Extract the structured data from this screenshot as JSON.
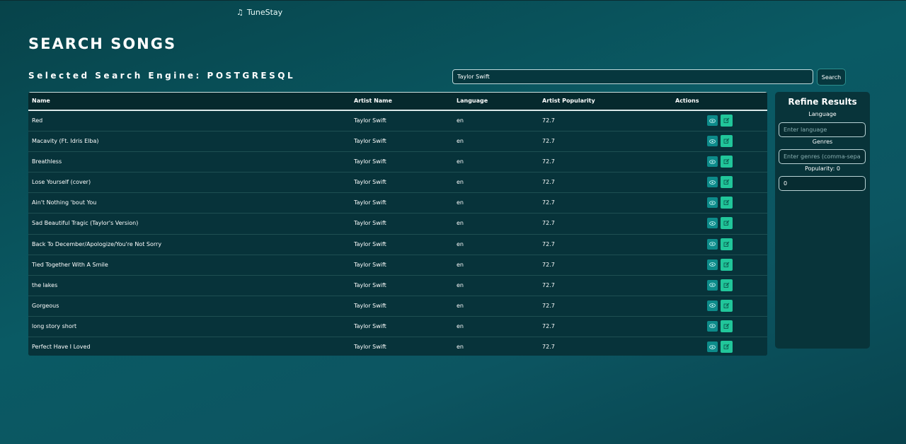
{
  "nav": {
    "brand": "TuneStay",
    "brand_icon": "music-note-icon"
  },
  "page": {
    "title": "SEARCH SONGS",
    "engine_label": "Selected Search Engine: POSTGRESQL"
  },
  "search": {
    "value": "Taylor Swift",
    "button_label": "Search"
  },
  "table": {
    "headers": {
      "name": "Name",
      "artist": "Artist Name",
      "language": "Language",
      "popularity": "Artist Popularity",
      "actions": "Actions"
    },
    "rows": [
      {
        "name": "Red",
        "artist": "Taylor Swift",
        "language": "en",
        "popularity": "72.7"
      },
      {
        "name": "Macavity (Ft. Idris Elba)",
        "artist": "Taylor Swift",
        "language": "en",
        "popularity": "72.7"
      },
      {
        "name": "Breathless",
        "artist": "Taylor Swift",
        "language": "en",
        "popularity": "72.7"
      },
      {
        "name": "Lose Yourself (cover)",
        "artist": "Taylor Swift",
        "language": "en",
        "popularity": "72.7"
      },
      {
        "name": "Ain't Nothing 'bout You",
        "artist": "Taylor Swift",
        "language": "en",
        "popularity": "72.7"
      },
      {
        "name": "Sad Beautiful Tragic (Taylor's Version)",
        "artist": "Taylor Swift",
        "language": "en",
        "popularity": "72.7"
      },
      {
        "name": "Back To December/Apologize/You're Not Sorry",
        "artist": "Taylor Swift",
        "language": "en",
        "popularity": "72.7"
      },
      {
        "name": "Tied Together With A Smile",
        "artist": "Taylor Swift",
        "language": "en",
        "popularity": "72.7"
      },
      {
        "name": "the lakes",
        "artist": "Taylor Swift",
        "language": "en",
        "popularity": "72.7"
      },
      {
        "name": "Gorgeous",
        "artist": "Taylor Swift",
        "language": "en",
        "popularity": "72.7"
      },
      {
        "name": "long story short",
        "artist": "Taylor Swift",
        "language": "en",
        "popularity": "72.7"
      },
      {
        "name": "Perfect Have I Loved",
        "artist": "Taylor Swift",
        "language": "en",
        "popularity": "72.7"
      }
    ]
  },
  "refine": {
    "title": "Refine Results",
    "language_label": "Language",
    "language_placeholder": "Enter language",
    "genres_label": "Genres",
    "genres_placeholder": "Enter genres (comma-separated)",
    "popularity_label": "Popularity: 0",
    "popularity_value": "0"
  },
  "colors": {
    "view_button": "#0d8b8a",
    "edit_button": "#21c69a",
    "panel": "#08343a"
  }
}
